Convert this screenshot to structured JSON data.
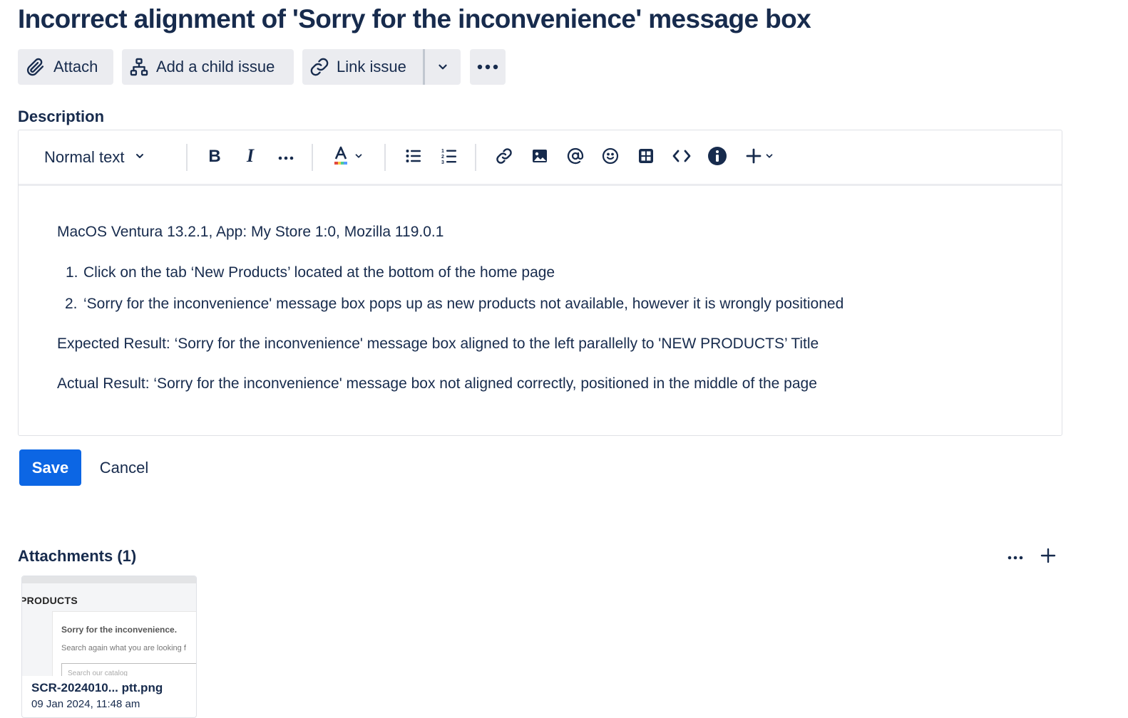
{
  "issue": {
    "title": "Incorrect alignment of 'Sorry for the inconvenience' message box"
  },
  "actions": {
    "attach": "Attach",
    "add_child": "Add a child issue",
    "link_issue": "Link issue"
  },
  "description": {
    "label": "Description",
    "toolbar": {
      "text_style": "Normal text"
    },
    "environment": "MacOS Ventura 13.2.1, App: My Store 1:0, Mozilla 119.0.1",
    "steps": [
      {
        "num": "1.",
        "text": "Click on the tab ‘New Products’ located at the bottom of the home page"
      },
      {
        "num": "2.",
        "text": " ‘Sorry for the inconvenience' message box pops up as new products not available, however it is wrongly positioned"
      }
    ],
    "expected": "Expected Result:  ‘Sorry for the inconvenience' message box aligned to the left parallelly to 'NEW PRODUCTS’ Title",
    "actual": "Actual Result: ‘Sorry for the inconvenience' message box not aligned correctly, positioned in the middle of the page"
  },
  "form": {
    "save": "Save",
    "cancel": "Cancel"
  },
  "attachments": {
    "title": "Attachments (1)",
    "items": [
      {
        "name": "SCR-2024010...  ptt.png",
        "date": "09 Jan 2024, 11:48 am",
        "thumb": {
          "heading": "PRODUCTS",
          "message": "Sorry for the inconvenience.",
          "hint": "Search again what you are looking f",
          "input_placeholder": "Search our catalog"
        }
      }
    ]
  },
  "colors": {
    "primary": "#0C66E4",
    "text": "#172B4D",
    "button_bg": "#EBECF0",
    "border": "#DFE1E6"
  }
}
